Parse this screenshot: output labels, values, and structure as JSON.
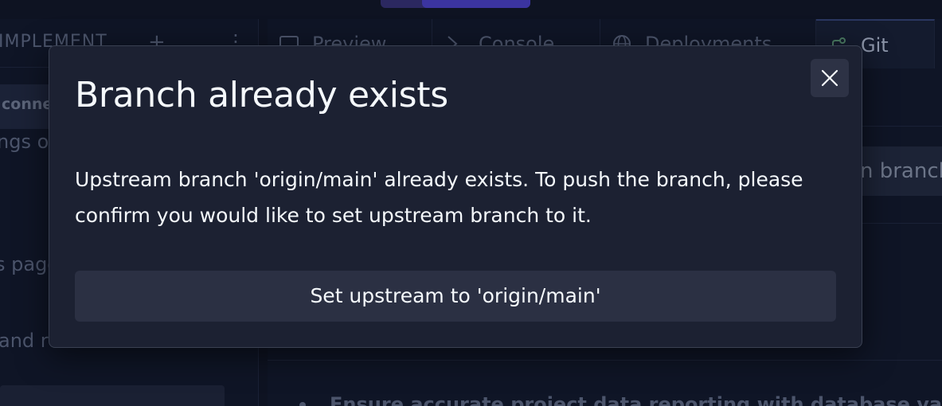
{
  "background": {
    "left_panel": {
      "title": "IMPLEMENT",
      "plus_glyph": "+",
      "kebab_glyph": "⋮",
      "chip_label": "conne",
      "text_lines": [
        "ngs o",
        "s page",
        "and run"
      ]
    },
    "tabs": [
      {
        "label": "Preview",
        "icon": "preview-icon"
      },
      {
        "label": "Console",
        "icon": "console-icon"
      },
      {
        "label": "Deployments",
        "icon": "globe-icon"
      },
      {
        "label": "Git",
        "icon": "git-branch-icon",
        "active": true
      }
    ],
    "branch_chip_label": "n branch",
    "bullet_text": "Ensure accurate project data reporting with database values"
  },
  "modal": {
    "title": "Branch already exists",
    "body_line1": "Upstream branch 'origin/main' already exists. To push the branch, please",
    "body_line2": "confirm you would like to set upstream branch to it.",
    "action_label": "Set upstream to 'origin/main'",
    "close_icon": "close-icon"
  },
  "colors": {
    "page_bg": "#0e1322",
    "modal_bg": "#1c2132",
    "modal_border": "#3a4152",
    "button_bg": "#2b3043",
    "text_primary": "#f5f9fc",
    "text_dimmed": "#4c556c",
    "accent": "#3b34a0"
  }
}
